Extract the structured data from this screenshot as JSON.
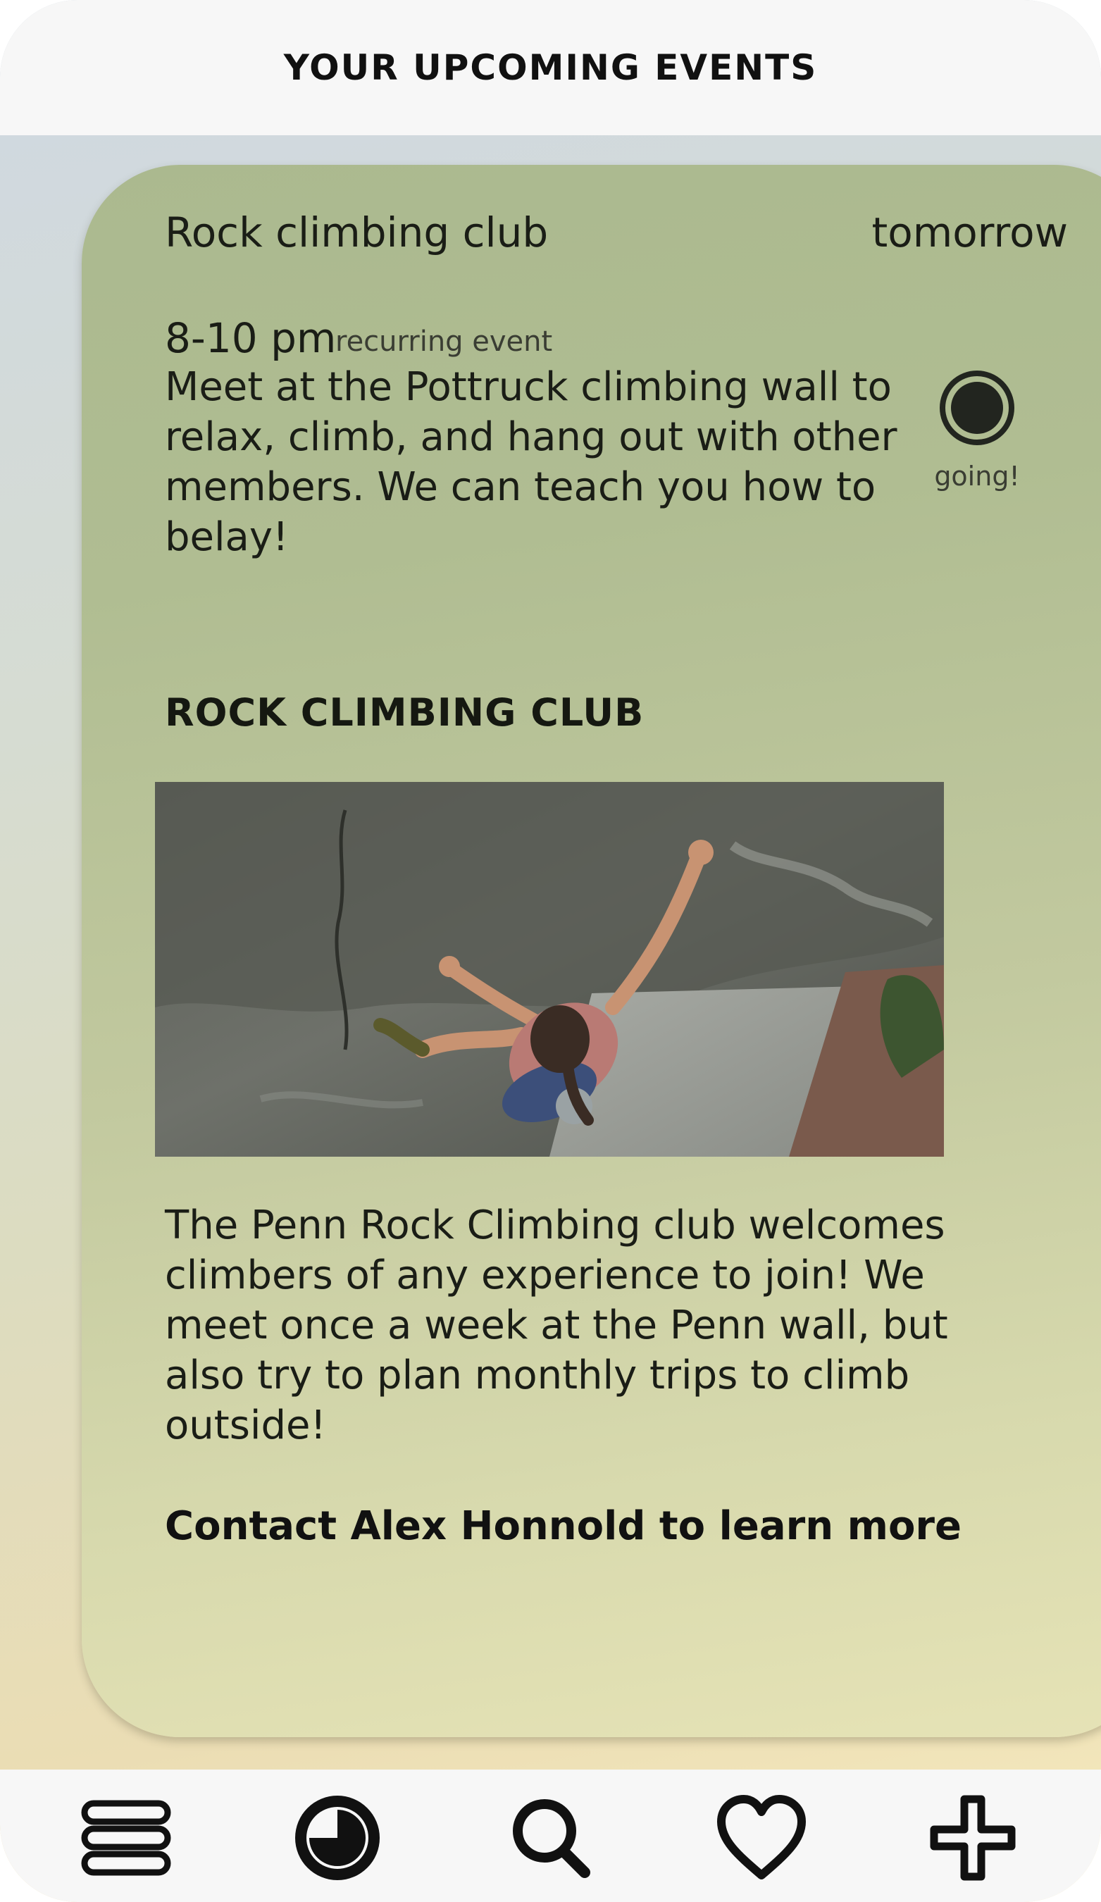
{
  "header": {
    "title": "YOUR UPCOMING EVENTS"
  },
  "event": {
    "name": "Rock climbing club",
    "when": "tomorrow",
    "time": "8-10 pm",
    "recurring_label": "recurring event",
    "description": "Meet at the Pottruck climbing wall to relax, climb, and hang out with other members. We can teach you how to belay!",
    "rsvp_status": "going!"
  },
  "club": {
    "heading": "ROCK CLIMBING CLUB",
    "photo": "rock-climber-photo",
    "description": "The Penn Rock Climbing club welcomes climbers of any experience to join! We meet once a week at the Penn wall, but also try to plan monthly trips to climb outside!",
    "contact_text": "Contact Alex Honnold to learn more"
  },
  "nav": {
    "items": [
      {
        "icon": "menu-icon"
      },
      {
        "icon": "upcoming-events-icon",
        "active": true
      },
      {
        "icon": "search-icon"
      },
      {
        "icon": "heart-icon"
      },
      {
        "icon": "plus-icon"
      }
    ]
  },
  "colors": {
    "card_top": "#abb98f",
    "card_bottom": "#e6e3b6",
    "bar_background": "#f7f7f7",
    "icon": "#111111"
  }
}
